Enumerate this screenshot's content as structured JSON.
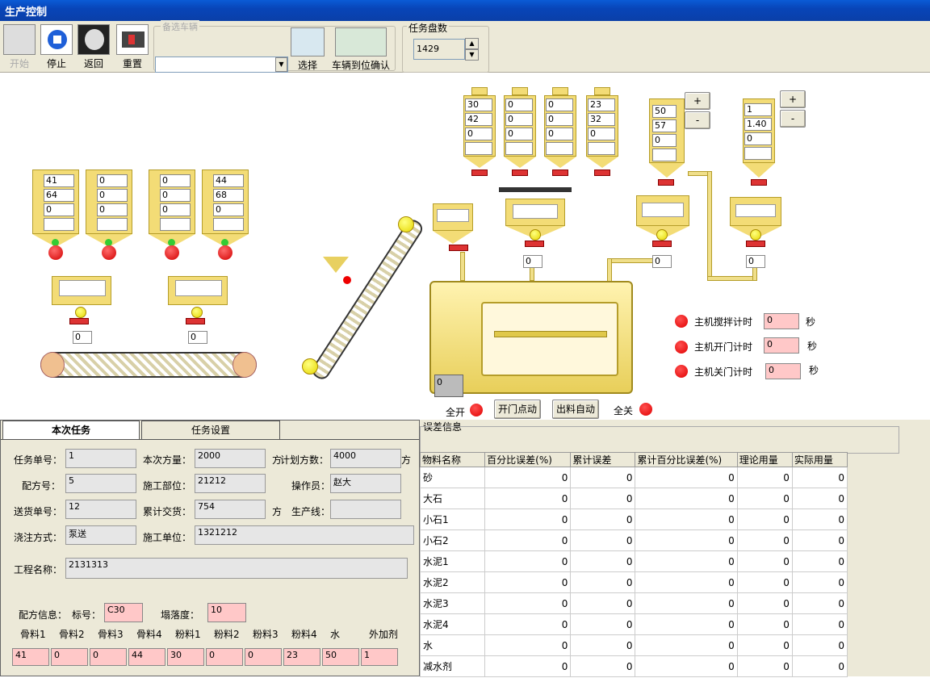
{
  "window": {
    "title": "生产控制"
  },
  "toolbar": {
    "start": "开始",
    "stop": "停止",
    "back": "返回",
    "reset": "重置",
    "vehicle_group": "备选车辆",
    "vehicle_value": "",
    "select": "选择",
    "arrive": "车辆到位确认",
    "task_count_label": "任务盘数",
    "task_count": "1429"
  },
  "agg_bins": [
    {
      "values": [
        "41",
        "64",
        "0",
        ""
      ]
    },
    {
      "values": [
        "0",
        "0",
        "0",
        ""
      ]
    },
    {
      "values": [
        "0",
        "0",
        "0",
        ""
      ]
    },
    {
      "values": [
        "44",
        "68",
        "0",
        ""
      ]
    }
  ],
  "agg_hoppers": [
    {
      "value": "0"
    },
    {
      "value": "0"
    }
  ],
  "top_silos": [
    {
      "values": [
        "30",
        "42",
        "0",
        ""
      ]
    },
    {
      "values": [
        "0",
        "0",
        "0",
        ""
      ]
    },
    {
      "values": [
        "0",
        "0",
        "0",
        ""
      ]
    },
    {
      "values": [
        "23",
        "32",
        "0",
        ""
      ]
    }
  ],
  "water_silo": {
    "values": [
      "50",
      "57",
      "0",
      ""
    ]
  },
  "additive_silo": {
    "values": [
      "1",
      "1.40",
      "0",
      ""
    ]
  },
  "scale_values": {
    "powder": "0",
    "water": "0",
    "additive": "0",
    "small": "0"
  },
  "plus": "+",
  "minus": "-",
  "mixer_value": "0",
  "timers": [
    {
      "label": "主机搅拌计时",
      "value": "0",
      "unit": "秒"
    },
    {
      "label": "主机开门计时",
      "value": "0",
      "unit": "秒"
    },
    {
      "label": "主机关门计时",
      "value": "0",
      "unit": "秒"
    }
  ],
  "controls": {
    "all_open": "全开",
    "door_jog": "开门点动",
    "auto_discharge": "出料自动",
    "all_close": "全关"
  },
  "tabs": {
    "current": "本次任务",
    "settings": "任务设置"
  },
  "task": {
    "task_no_label": "任务单号：",
    "task_no": "1",
    "volume_label": "本次方量：",
    "volume": "2000",
    "volume_unit": "方",
    "plan_label": "计划方数：",
    "plan": "4000",
    "plan_unit": "方",
    "recipe_label": "配方号：",
    "recipe": "5",
    "part_label": "施工部位：",
    "part": "21212",
    "operator_label": "操作员：",
    "operator": "赵大",
    "delivery_label": "送货单号：",
    "delivery": "12",
    "cumulative_label": "累计交货：",
    "cumulative": "754",
    "cumulative_unit": "方",
    "line_label": "生产线：",
    "line": "",
    "pour_label": "浇注方式：",
    "pour": "泵送",
    "unit_label": "施工单位：",
    "unit": "1321212",
    "project_label": "工程名称：",
    "project": "2131313",
    "mix_label": "配方信息：",
    "grade_label": "标号：",
    "grade": "C30",
    "slump_label": "塌落度：",
    "slump": "10"
  },
  "mix_columns": [
    {
      "name": "骨料1",
      "value": "41"
    },
    {
      "name": "骨料2",
      "value": "0"
    },
    {
      "name": "骨料3",
      "value": "0"
    },
    {
      "name": "骨料4",
      "value": "44"
    },
    {
      "name": "粉料1",
      "value": "30"
    },
    {
      "name": "粉料2",
      "value": "0"
    },
    {
      "name": "粉料3",
      "value": "0"
    },
    {
      "name": "粉料4",
      "value": "23"
    },
    {
      "name": "水",
      "value": "50"
    },
    {
      "name": "外加剂",
      "value": "1"
    }
  ],
  "error_panel": {
    "title": "误差信息",
    "headers": [
      "物料名称",
      "百分比误差(%)",
      "累计误差",
      "累计百分比误差(%)",
      "理论用量",
      "实际用量"
    ],
    "rows": [
      [
        "砂",
        "0",
        "0",
        "0",
        "0",
        "0"
      ],
      [
        "大石",
        "0",
        "0",
        "0",
        "0",
        "0"
      ],
      [
        "小石1",
        "0",
        "0",
        "0",
        "0",
        "0"
      ],
      [
        "小石2",
        "0",
        "0",
        "0",
        "0",
        "0"
      ],
      [
        "水泥1",
        "0",
        "0",
        "0",
        "0",
        "0"
      ],
      [
        "水泥2",
        "0",
        "0",
        "0",
        "0",
        "0"
      ],
      [
        "水泥3",
        "0",
        "0",
        "0",
        "0",
        "0"
      ],
      [
        "水泥4",
        "0",
        "0",
        "0",
        "0",
        "0"
      ],
      [
        "水",
        "0",
        "0",
        "0",
        "0",
        "0"
      ],
      [
        "减水剂",
        "0",
        "0",
        "0",
        "0",
        "0"
      ]
    ]
  }
}
